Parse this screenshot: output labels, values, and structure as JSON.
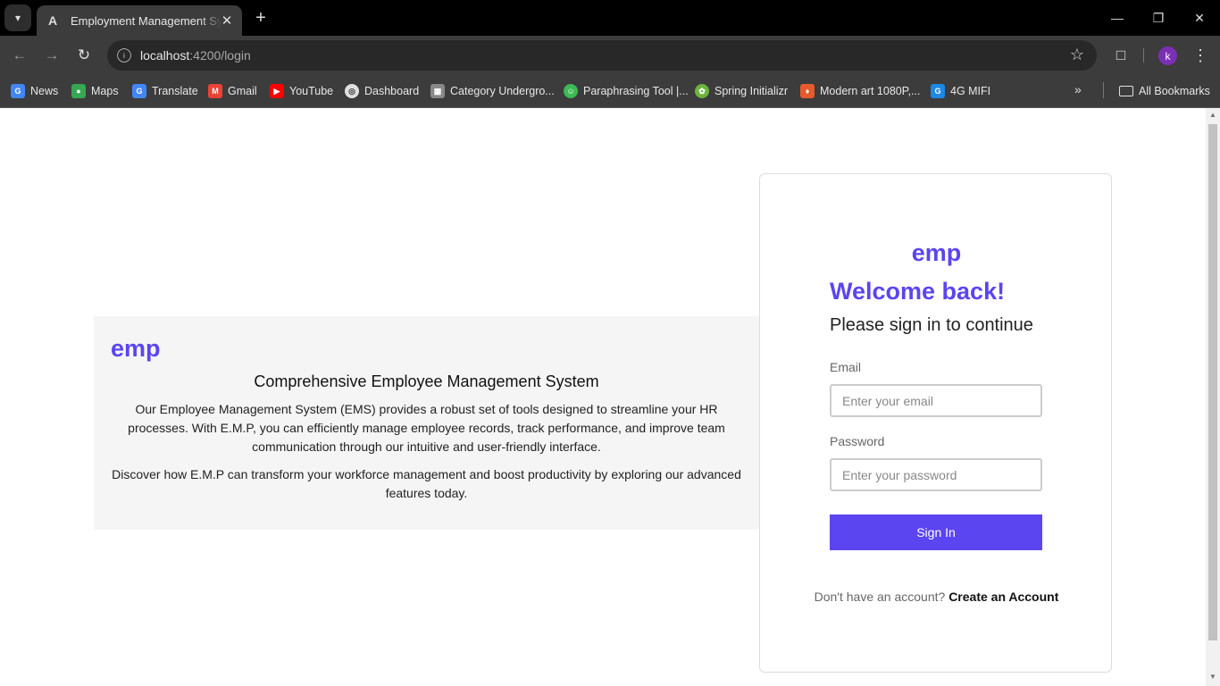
{
  "browser": {
    "tab_title": "Employment Management System",
    "tab_favicon": "A",
    "url_host": "localhost",
    "url_path": ":4200/login",
    "profile_initial": "k",
    "bookmarks": [
      {
        "label": "News",
        "icon": "news-icon",
        "color": "#4285f4"
      },
      {
        "label": "Maps",
        "icon": "maps-icon",
        "color": "#34a853"
      },
      {
        "label": "Translate",
        "icon": "translate-icon",
        "color": "#4285f4"
      },
      {
        "label": "Gmail",
        "icon": "gmail-icon",
        "color": "#ea4335"
      },
      {
        "label": "YouTube",
        "icon": "youtube-icon",
        "color": "#ff0000"
      },
      {
        "label": "Dashboard",
        "icon": "globe-icon",
        "color": "#e0e0e0"
      },
      {
        "label": "Category Undergro...",
        "icon": "category-icon",
        "color": "#888888"
      },
      {
        "label": "Paraphrasing Tool |...",
        "icon": "paraphrasing-icon",
        "color": "#3cba54"
      },
      {
        "label": "Spring Initializr",
        "icon": "spring-icon",
        "color": "#6db33f"
      },
      {
        "label": "Modern art 1080P,...",
        "icon": "art-icon",
        "color": "#e55b2d"
      },
      {
        "label": "4G MIFI",
        "icon": "mifi-icon",
        "color": "#1e88e5"
      }
    ],
    "all_bookmarks": "All Bookmarks"
  },
  "info": {
    "logo": "emp",
    "title": "Comprehensive Employee Management System",
    "paragraph1": "Our Employee Management System (EMS) provides a robust set of tools designed to streamline your HR processes. With E.M.P, you can efficiently manage employee records, track performance, and improve team communication through our intuitive and user-friendly interface.",
    "paragraph2": "Discover how E.M.P can transform your workforce management and boost productivity by exploring our advanced features today."
  },
  "login": {
    "logo": "emp",
    "welcome": "Welcome back!",
    "subtitle": "Please sign in to continue",
    "email_label": "Email",
    "email_placeholder": "Enter your email",
    "password_label": "Password",
    "password_placeholder": "Enter your password",
    "signin_label": "Sign In",
    "footer_text": "Don't have an account?",
    "create_account": "Create an Account"
  },
  "colors": {
    "brand": "#5b45f0"
  }
}
